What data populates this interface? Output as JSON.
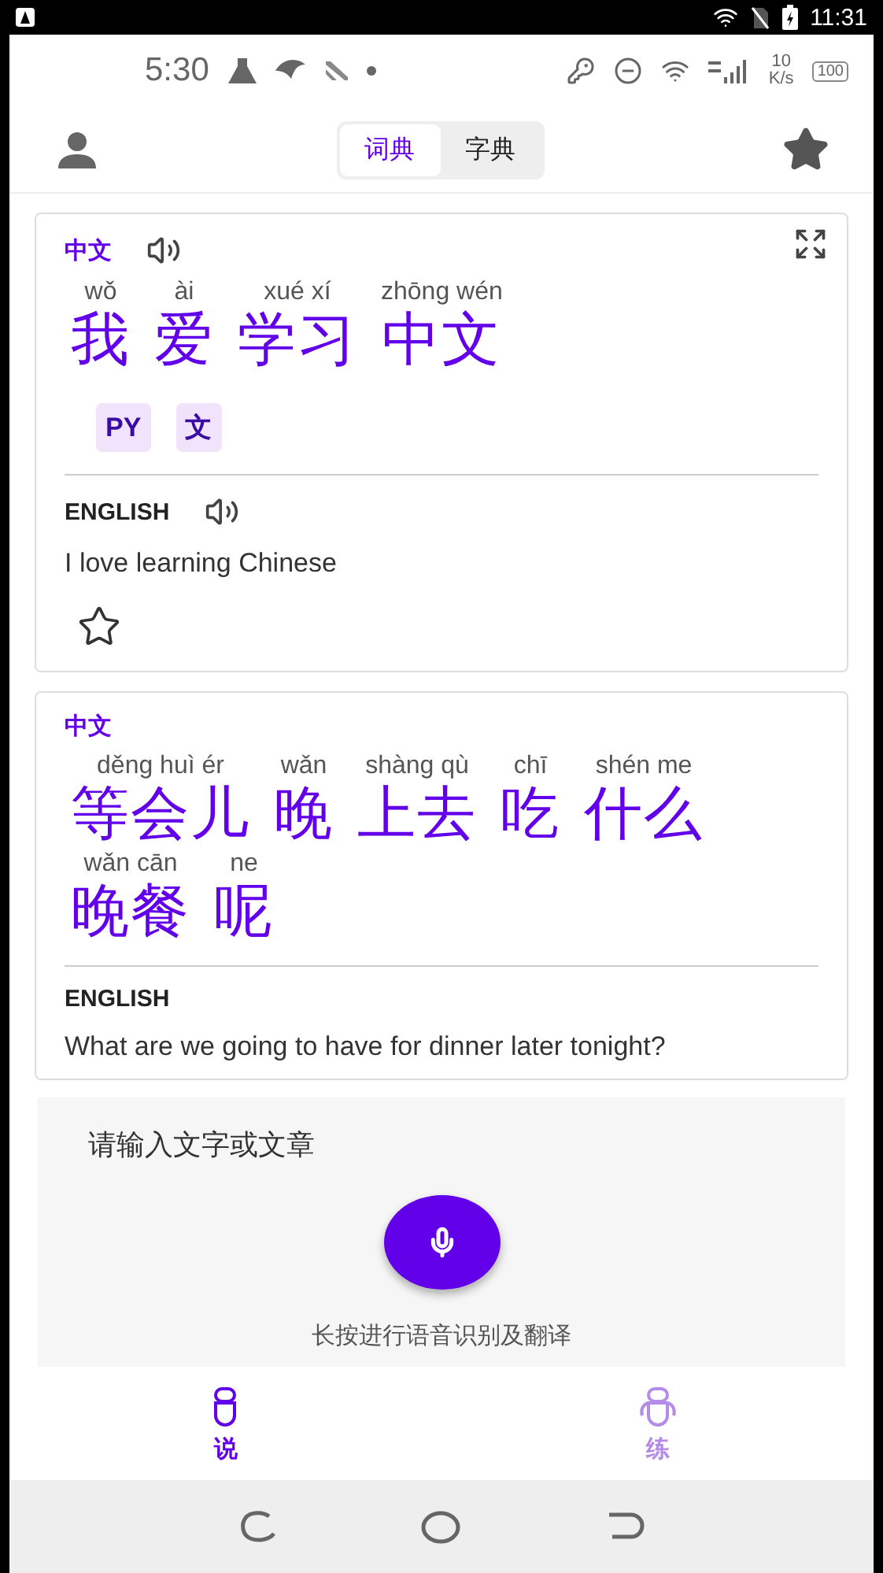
{
  "system_bar": {
    "time": "11:31"
  },
  "status_bar": {
    "time": "5:30",
    "speed_value": "10",
    "speed_unit": "K/s",
    "battery": "100"
  },
  "header": {
    "tabs": [
      {
        "label": "词典",
        "selected": true
      },
      {
        "label": "字典",
        "selected": false
      }
    ]
  },
  "cards": [
    {
      "kind": "full",
      "language": "中文",
      "words": [
        {
          "pinyin": "wǒ",
          "hanzi": "我"
        },
        {
          "pinyin": "ài",
          "hanzi": "爱"
        },
        {
          "pinyin": "xué xí",
          "hanzi": "学习"
        },
        {
          "pinyin": "zhōng wén",
          "hanzi": "中文"
        }
      ],
      "chips": [
        "PY",
        "文"
      ],
      "english_label": "ENGLISH",
      "english": "I love learning Chinese"
    },
    {
      "kind": "partial",
      "language": "中文",
      "words": [
        {
          "pinyin": "děng huì ér",
          "hanzi": "等会儿"
        },
        {
          "pinyin": "wǎn",
          "hanzi": "晚"
        },
        {
          "pinyin": "shàng qù",
          "hanzi": "上去"
        },
        {
          "pinyin": "chī",
          "hanzi": "吃"
        },
        {
          "pinyin": "shén me",
          "hanzi": "什么"
        },
        {
          "pinyin": "wǎn cān",
          "hanzi": "晚餐"
        },
        {
          "pinyin": "ne",
          "hanzi": "呢"
        }
      ],
      "english_label": "ENGLISH",
      "english": "What are we going to have for dinner later tonight?"
    }
  ],
  "input_panel": {
    "placeholder": "请输入文字或文章",
    "hint": "长按进行语音识别及翻译"
  },
  "bottom_nav": [
    {
      "label": "说",
      "selected": true
    },
    {
      "label": "练",
      "selected": false
    }
  ]
}
